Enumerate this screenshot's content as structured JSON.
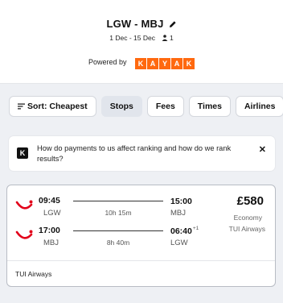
{
  "header": {
    "route": "LGW - MBJ",
    "dates": "1 Dec - 15 Dec",
    "travellers": "1",
    "powered_by": "Powered by",
    "brand_letters": [
      "K",
      "A",
      "Y",
      "A",
      "K"
    ]
  },
  "filters": [
    {
      "label": "Sort: Cheapest",
      "active": false
    },
    {
      "label": "Stops",
      "active": true
    },
    {
      "label": "Fees",
      "active": false
    },
    {
      "label": "Times",
      "active": false
    },
    {
      "label": "Airlines",
      "active": false
    }
  ],
  "notice": {
    "logo": "K",
    "text": "How do payments to us affect ranking and how do we rank results?",
    "close": "✕"
  },
  "result": {
    "outbound": {
      "dep_time": "09:45",
      "dep_airport": "LGW",
      "duration": "10h 15m",
      "arr_time": "15:00",
      "arr_offset": "",
      "arr_airport": "MBJ"
    },
    "inbound": {
      "dep_time": "17:00",
      "dep_airport": "MBJ",
      "duration": "8h 40m",
      "arr_time": "06:40",
      "arr_offset": "+1",
      "arr_airport": "LGW"
    },
    "price": "£580",
    "cabin": "Economy",
    "carrier": "TUI Airways",
    "footer_airline": "TUI Airways"
  },
  "colors": {
    "brand": "#ff690f",
    "tui_red": "#e2001a",
    "active_chip": "#e1e5ec"
  }
}
